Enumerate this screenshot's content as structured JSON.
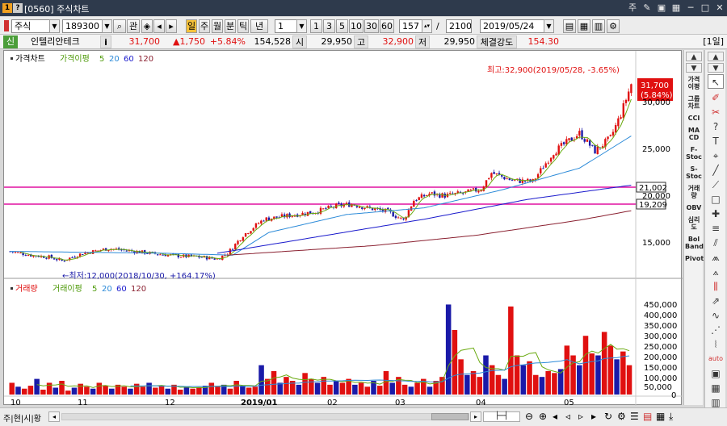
{
  "titlebar": {
    "badge1": "1",
    "badge2": "?",
    "title": "[0560] 주식차트",
    "win_icons": [
      "주",
      "✎",
      "▣",
      "▦",
      "─",
      "□",
      "✕"
    ]
  },
  "toolbar": {
    "market": "주식",
    "code": "189300",
    "search_icon": "search-icon",
    "gwan": "관",
    "periods": [
      "일",
      "주",
      "월",
      "분",
      "틱",
      "년"
    ],
    "count_select": "1",
    "intervals": [
      "1",
      "3",
      "5",
      "10",
      "30",
      "60"
    ],
    "bar_count": "157",
    "slash": "/",
    "total": "2100",
    "date": "2019/05/24"
  },
  "quote": {
    "badge": "신",
    "name": "인텔리안테크",
    "info": "i",
    "price": "31,700",
    "change": "▲1,750",
    "pct": "+5.84%",
    "volume": "154,528",
    "open_label": "시",
    "open": "29,950",
    "high_label": "고",
    "high": "32,900",
    "low_label": "저",
    "low": "29,950",
    "strength_label": "체결강도",
    "strength": "154.30",
    "period_tag": "[1일]"
  },
  "price_panel": {
    "legend_title": "가격차트",
    "legend_ma": "가격이평",
    "ma_periods": [
      "5",
      "20",
      "60",
      "120"
    ],
    "max_annot": "최고:32,900(2019/05/28, -3.65%)",
    "min_annot": "←최저:12,000(2018/10/30, +164.17%)",
    "last_price": "31,700",
    "last_pct": "(5.84%)",
    "y_ticks": [
      "30,000",
      "25,000",
      "20,000",
      "15,000"
    ],
    "hlines": [
      "21,002",
      "19,209"
    ]
  },
  "volume_panel": {
    "legend_title": "거래량",
    "legend_ma": "거래이평",
    "ma_periods": [
      "5",
      "20",
      "60",
      "120"
    ],
    "y_ticks": [
      "450,000",
      "400,000",
      "350,000",
      "300,000",
      "250,000",
      "200,000",
      "150,000",
      "100,000",
      "50,000",
      "0"
    ]
  },
  "x_ticks": [
    "10",
    "11",
    "12",
    "2019/01",
    "02",
    "03",
    "04",
    "05"
  ],
  "indicators": [
    "가격\n이평",
    "그룹\n차트",
    "CCI",
    "MA\nCD",
    "F-\nStoc",
    "S-\nStoc",
    "거래\n량",
    "OBV",
    "심리\n도",
    "Bol\nBand",
    "Pivot"
  ],
  "bottombar": {
    "label": "주|현|시|황"
  },
  "colors": {
    "up": "#e01010",
    "down": "#1a1aa8",
    "ma5": "#6aaa10",
    "ma20": "#2b8ad8",
    "ma60": "#1a1acc",
    "ma120": "#8a2030",
    "hline": "#e010a0"
  },
  "chart_data": {
    "type": "candlestick",
    "x_start": "2018-10",
    "x_end": "2019-05-24",
    "ylim": [
      12000,
      33500
    ],
    "support_lines": [
      21002,
      19209
    ],
    "max": {
      "value": 32900,
      "date": "2019/05/28"
    },
    "min": {
      "value": 12000,
      "date": "2018/10/30"
    },
    "last_close": 31700,
    "close_path": [
      [
        0,
        14000
      ],
      [
        8,
        13600
      ],
      [
        15,
        13400
      ],
      [
        20,
        13000
      ],
      [
        28,
        13800
      ],
      [
        38,
        14300
      ],
      [
        48,
        14000
      ],
      [
        58,
        13700
      ],
      [
        66,
        13500
      ],
      [
        74,
        13400
      ],
      [
        80,
        13200
      ],
      [
        84,
        13800
      ],
      [
        90,
        15700
      ],
      [
        98,
        17400
      ],
      [
        108,
        17800
      ],
      [
        118,
        18200
      ],
      [
        126,
        18800
      ],
      [
        132,
        19000
      ],
      [
        138,
        18600
      ],
      [
        146,
        18200
      ],
      [
        152,
        17300
      ],
      [
        156,
        19400
      ],
      [
        162,
        20100
      ],
      [
        168,
        19900
      ],
      [
        176,
        20200
      ],
      [
        182,
        20600
      ],
      [
        186,
        22300
      ],
      [
        194,
        21500
      ],
      [
        202,
        21400
      ],
      [
        210,
        24500
      ],
      [
        220,
        26500
      ],
      [
        226,
        24600
      ],
      [
        232,
        26000
      ],
      [
        236,
        28500
      ],
      [
        240,
        31700
      ]
    ],
    "ma20_path": [
      [
        0,
        14000
      ],
      [
        30,
        13900
      ],
      [
        60,
        13800
      ],
      [
        86,
        13600
      ],
      [
        100,
        16000
      ],
      [
        130,
        17900
      ],
      [
        160,
        18600
      ],
      [
        190,
        20500
      ],
      [
        220,
        22800
      ],
      [
        240,
        26200
      ]
    ],
    "ma60_path": [
      [
        80,
        13800
      ],
      [
        120,
        15600
      ],
      [
        160,
        17400
      ],
      [
        200,
        19500
      ],
      [
        240,
        21000
      ]
    ],
    "ma120_path": [
      [
        84,
        13600
      ],
      [
        140,
        14600
      ],
      [
        180,
        15700
      ],
      [
        220,
        17300
      ],
      [
        240,
        18300
      ]
    ],
    "volume_values": [
      60000,
      40000,
      30000,
      45000,
      80000,
      25000,
      60000,
      35000,
      70000,
      20000,
      35000,
      55000,
      40000,
      30000,
      60000,
      45000,
      30000,
      50000,
      40000,
      30000,
      55000,
      40000,
      60000,
      35000,
      45000,
      30000,
      50000,
      25000,
      40000,
      30000,
      35000,
      45000,
      60000,
      40000,
      50000,
      30000,
      70000,
      45000,
      35000,
      40000,
      150000,
      80000,
      120000,
      60000,
      90000,
      70000,
      50000,
      110000,
      80000,
      60000,
      90000,
      50000,
      70000,
      60000,
      80000,
      50000,
      60000,
      40000,
      70000,
      45000,
      120000,
      60000,
      90000,
      50000,
      40000,
      60000,
      80000,
      40000,
      70000,
      90000,
      460000,
      330000,
      180000,
      100000,
      120000,
      90000,
      200000,
      150000,
      100000,
      80000,
      450000,
      200000,
      150000,
      170000,
      100000,
      90000,
      120000,
      110000,
      130000,
      250000,
      200000,
      150000,
      300000,
      210000,
      200000,
      320000,
      250000,
      180000,
      220000,
      150000
    ]
  }
}
